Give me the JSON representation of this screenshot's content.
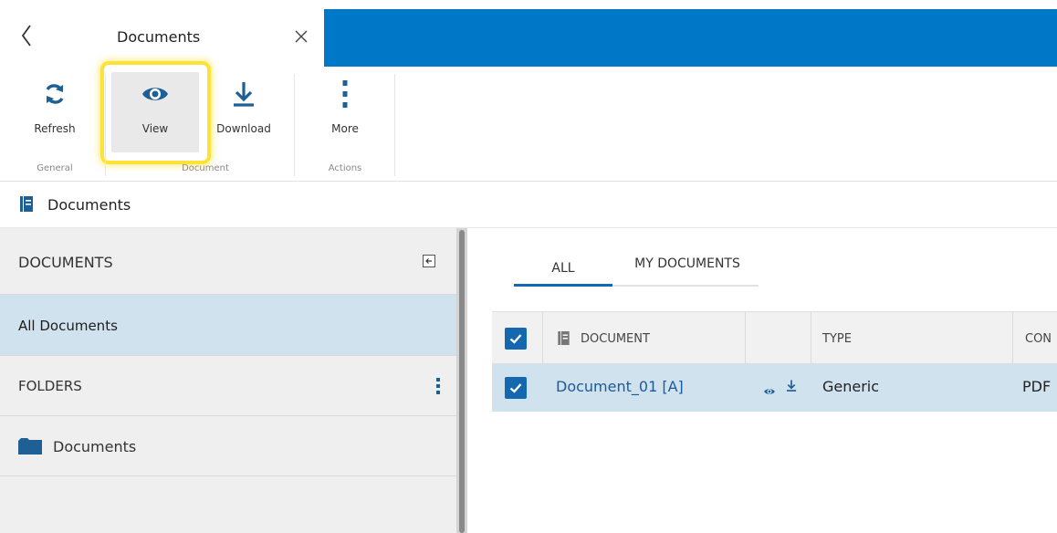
{
  "top": {
    "title": "Documents",
    "brand_color": "#0078c8"
  },
  "ribbon": {
    "buttons": [
      {
        "label": "Refresh",
        "icon": "refresh-icon"
      },
      {
        "label": "View",
        "icon": "eye-icon"
      },
      {
        "label": "Download",
        "icon": "download-icon"
      },
      {
        "label": "More",
        "icon": "more-vertical-icon"
      }
    ],
    "groups": [
      "General",
      "Document",
      "Actions"
    ],
    "highlight_color": "#ffe238"
  },
  "header": {
    "title": "Documents"
  },
  "sidebar": {
    "title": "DOCUMENTS",
    "all_documents": "All Documents",
    "folders_title": "FOLDERS",
    "folder_item": "Documents"
  },
  "tabs": [
    "ALL",
    "MY DOCUMENTS"
  ],
  "grid": {
    "columns": [
      "DOCUMENT",
      "",
      "TYPE",
      "CON"
    ],
    "rows": [
      {
        "document": "Document_01 [A]",
        "type": "Generic",
        "con": "PDF",
        "selected": true
      }
    ]
  }
}
